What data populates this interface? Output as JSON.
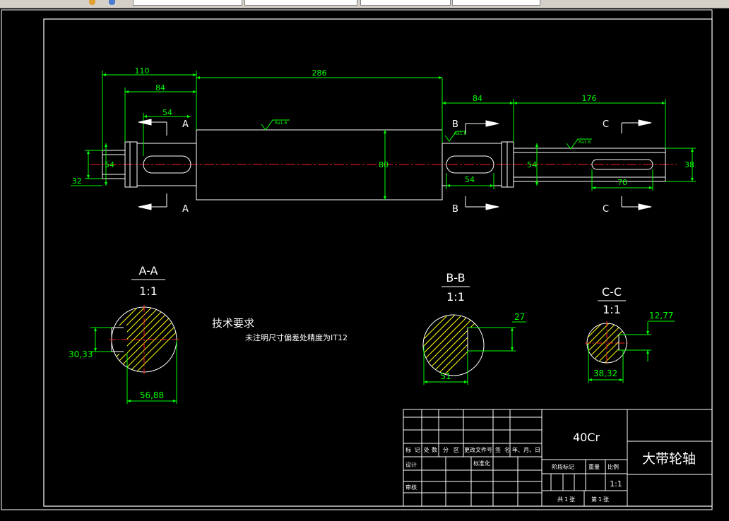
{
  "drawing": {
    "part_name": "大带轮轴",
    "material": "40Cr",
    "scale_value": "1:1",
    "tech_requirements": {
      "heading": "技术要求",
      "line1": "未注明尺寸偏差处精度为IT12"
    },
    "dims": {
      "d110": "110",
      "d84a": "84",
      "d54a": "54",
      "d286": "286",
      "d84b": "84",
      "d176": "176",
      "d32": "32",
      "d54dia_left": "54",
      "d80": "80",
      "d54b": "54",
      "d54dia_right": "54",
      "d70": "70",
      "d38": "38"
    },
    "roughness": {
      "r1": "Ra1.6",
      "r2": "Ra1.6",
      "r3": "Ra1.6"
    },
    "section_markers": {
      "a_top": "A",
      "a_bot": "A",
      "b_top": "B",
      "b_bot": "B",
      "c_top": "C",
      "c_bot": "C"
    },
    "sections": {
      "aa": {
        "title": "A-A",
        "scale": "1:1",
        "dim_h": "30,33",
        "dim_w": "56,88"
      },
      "bb": {
        "title": "B-B",
        "scale": "1:1",
        "dim_h": "27",
        "dim_w": "51"
      },
      "cc": {
        "title": "C-C",
        "scale": "1:1",
        "dim_h": "12,77",
        "dim_w": "38,32"
      }
    },
    "title_block": {
      "r1": [
        "标",
        "记",
        "处",
        "数",
        "分",
        "区",
        "更改文件号",
        "签",
        "名",
        "年、月、日"
      ],
      "sheji": "设计",
      "biaozhunhua": "标准化",
      "shenhe": "审核",
      "jieduan": "阶段标记",
      "zhongliang": "重量",
      "bili": "比例",
      "gong": "共",
      "zhang1": "1",
      "zhang_label1": "张",
      "di": "第",
      "zhang2": "1",
      "zhang_label2": "张"
    }
  },
  "colors": {
    "background": "#000000",
    "outline": "#ffffff",
    "dimension": "#00ff00",
    "centerline": "#ff2020",
    "hatch": "#ffff00",
    "frame": "#ffffff"
  },
  "icons": [
    "layer-icon",
    "color-icon"
  ]
}
